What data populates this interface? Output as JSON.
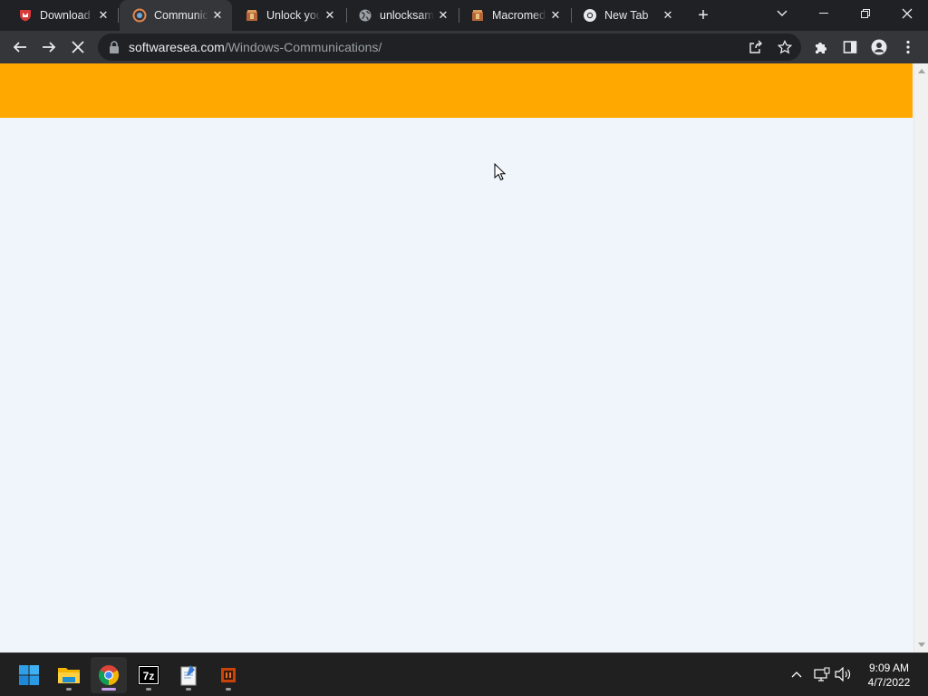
{
  "tabs": [
    {
      "title": "Download V",
      "favicon": "shield-red-icon",
      "active": false
    },
    {
      "title": "Communica",
      "favicon": "softwaresea-icon",
      "active": true
    },
    {
      "title": "Unlock you",
      "favicon": "archive-box-icon",
      "active": false
    },
    {
      "title": "unlocksama",
      "favicon": "globe-icon",
      "active": false
    },
    {
      "title": "Macromedi",
      "favicon": "archive-box-icon",
      "active": false
    },
    {
      "title": "New Tab",
      "favicon": "chrome-icon",
      "active": false
    }
  ],
  "close_glyph": "✕",
  "new_tab_glyph": "+",
  "address": {
    "domain": "softwaresea.com",
    "path": "/Windows-Communications/"
  },
  "page": {
    "banner_color": "#ffa800",
    "background_color": "#f0f4fb"
  },
  "clock": {
    "time": "9:09 AM",
    "date": "4/7/2022"
  },
  "taskbar_apps": [
    "start-icon",
    "file-explorer-icon",
    "chrome-icon",
    "7zip-icon",
    "notepad-icon",
    "app-icon"
  ]
}
